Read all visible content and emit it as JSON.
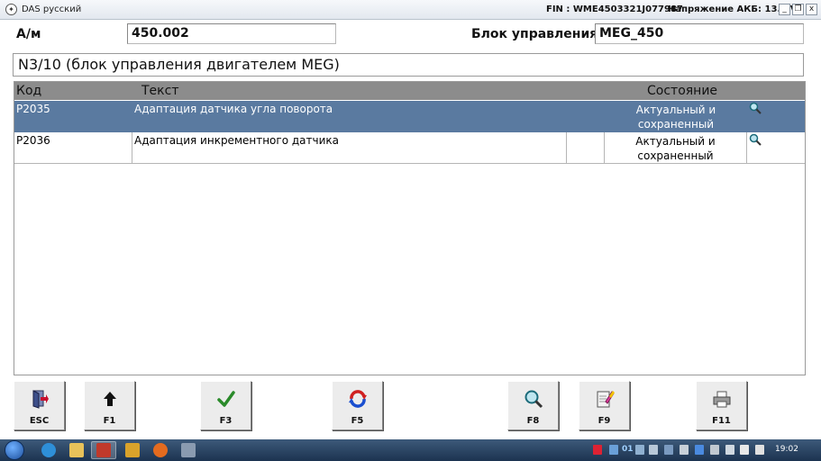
{
  "window": {
    "title": "DAS русский",
    "fin": "FIN : WME4503321J077987",
    "battery_voltage": "Напряжение АКБ: 13.5 V",
    "buttons": {
      "minimize": "_",
      "restore": "❐",
      "close": "x"
    }
  },
  "header": {
    "am_label": "А/м",
    "am_value": "450.002",
    "ecu_label": "Блок управления",
    "ecu_value": "MEG_450",
    "ecu_title": "N3/10 (блок управления двигателем MEG)"
  },
  "table": {
    "columns": {
      "code": "Код",
      "text": "Текст",
      "state": "Состояние"
    },
    "rows": [
      {
        "code": "P2035",
        "text": "Адаптация датчика угла поворота",
        "state_line1": "Актуальный и",
        "state_line2": "сохраненный",
        "selected": true
      },
      {
        "code": "P2036",
        "text": "Адаптация инкрементного датчика",
        "state_line1": "Актуальный и",
        "state_line2": "сохраненный",
        "selected": false
      }
    ]
  },
  "function_keys": [
    {
      "key": "ESC",
      "icon": "exit-door-icon"
    },
    {
      "key": "F1",
      "icon": "arrow-up-icon"
    },
    {
      "key": "F3",
      "icon": "checkmark-icon"
    },
    {
      "key": "F5",
      "icon": "refresh-icon"
    },
    {
      "key": "F8",
      "icon": "magnifier-icon"
    },
    {
      "key": "F9",
      "icon": "notepad-pen-icon"
    },
    {
      "key": "F11",
      "icon": "printer-icon"
    }
  ],
  "taskbar": {
    "clock": "19:02",
    "tray_lang": "01"
  },
  "colors": {
    "selected_row": "#5a7aa0",
    "table_header": "#8c8c8c",
    "checkmark": "#2a8a2a",
    "refresh_red": "#d02020",
    "refresh_blue": "#1a4fd0"
  }
}
